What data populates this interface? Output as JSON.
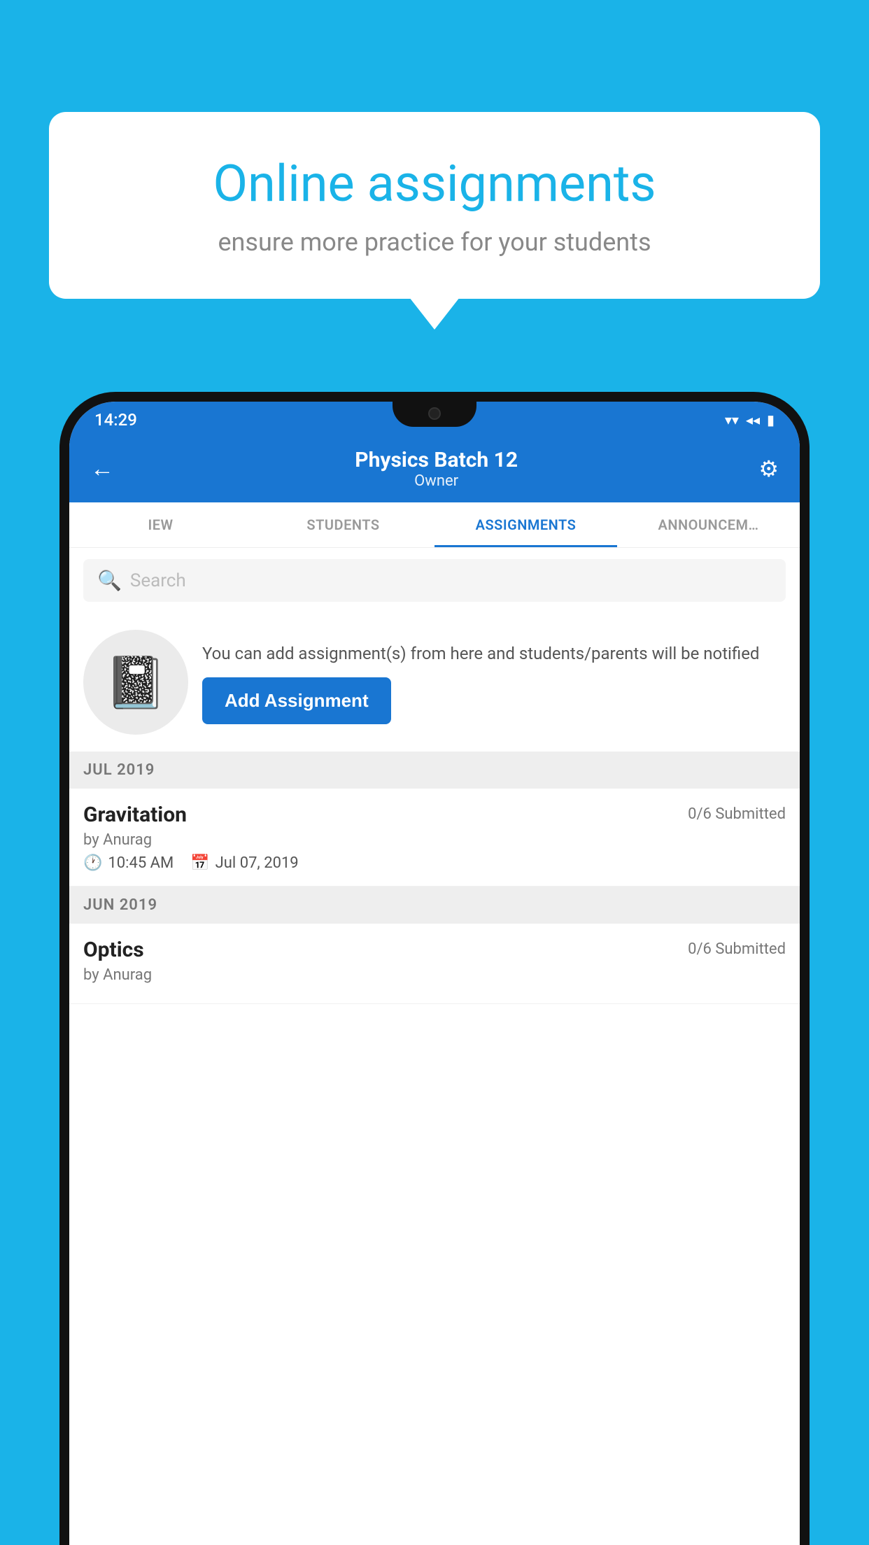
{
  "background_color": "#1ab3e8",
  "speech_bubble": {
    "title": "Online assignments",
    "subtitle": "ensure more practice for your students"
  },
  "status_bar": {
    "time": "14:29",
    "wifi_icon": "▼",
    "signal_icon": "◀",
    "battery_icon": "▮"
  },
  "app_header": {
    "back_icon": "←",
    "title": "Physics Batch 12",
    "subtitle": "Owner",
    "settings_icon": "⚙"
  },
  "tabs": [
    {
      "label": "IEW",
      "active": false
    },
    {
      "label": "STUDENTS",
      "active": false
    },
    {
      "label": "ASSIGNMENTS",
      "active": true
    },
    {
      "label": "ANNOUNCEM…",
      "active": false
    }
  ],
  "search": {
    "placeholder": "Search"
  },
  "promo": {
    "text": "You can add assignment(s) from here and students/parents will be notified",
    "button_label": "Add Assignment"
  },
  "sections": [
    {
      "month": "JUL 2019",
      "assignments": [
        {
          "name": "Gravitation",
          "submitted": "0/6 Submitted",
          "by": "by Anurag",
          "time": "10:45 AM",
          "date": "Jul 07, 2019"
        }
      ]
    },
    {
      "month": "JUN 2019",
      "assignments": [
        {
          "name": "Optics",
          "submitted": "0/6 Submitted",
          "by": "by Anurag",
          "time": "",
          "date": ""
        }
      ]
    }
  ]
}
